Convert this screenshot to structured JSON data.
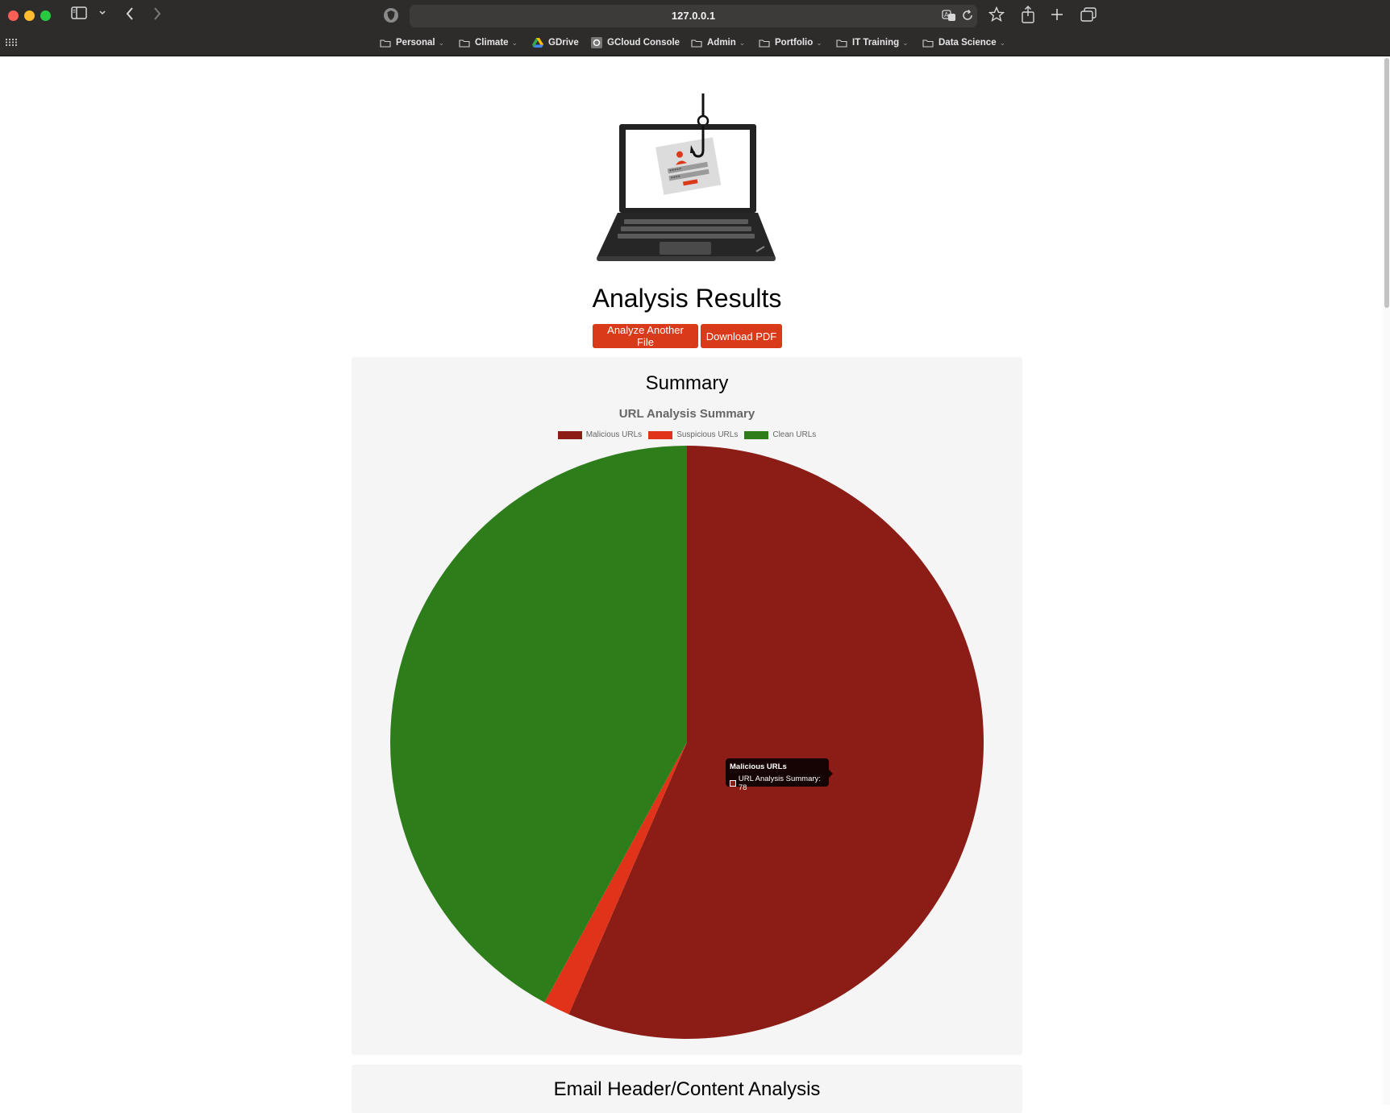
{
  "browser": {
    "url": "127.0.0.1",
    "bookmarks": [
      {
        "label": "Personal",
        "icon": "folder-icon",
        "dropdown": true
      },
      {
        "label": "Climate",
        "icon": "folder-icon",
        "dropdown": true
      },
      {
        "label": "GDrive",
        "icon": "google-drive-icon",
        "dropdown": false
      },
      {
        "label": "GCloud Console",
        "icon": "gcloud-icon",
        "dropdown": false
      },
      {
        "label": "Admin",
        "icon": "folder-icon",
        "dropdown": true
      },
      {
        "label": "Portfolio",
        "icon": "folder-icon",
        "dropdown": true
      },
      {
        "label": "IT Training",
        "icon": "folder-icon",
        "dropdown": true
      },
      {
        "label": "Data Science",
        "icon": "folder-icon",
        "dropdown": true
      }
    ]
  },
  "page": {
    "title": "Analysis Results",
    "buttons": {
      "analyze_another": "Analyze Another File",
      "download_pdf": "Download PDF"
    },
    "accent_color": "#d93a1a"
  },
  "summary": {
    "heading": "Summary"
  },
  "email_analysis": {
    "heading": "Email Header/Content Analysis"
  },
  "tooltip": {
    "title": "Malicious URLs",
    "body": "URL Analysis Summary: 78"
  },
  "chart_data": {
    "type": "pie",
    "title": "URL Analysis Summary",
    "legend_position": "top",
    "series_name": "URL Analysis Summary",
    "categories": [
      "Malicious URLs",
      "Suspicious URLs",
      "Clean URLs"
    ],
    "values": [
      78,
      2,
      58
    ],
    "colors": [
      "#8b1c16",
      "#e0331a",
      "#2e7d1b"
    ]
  }
}
